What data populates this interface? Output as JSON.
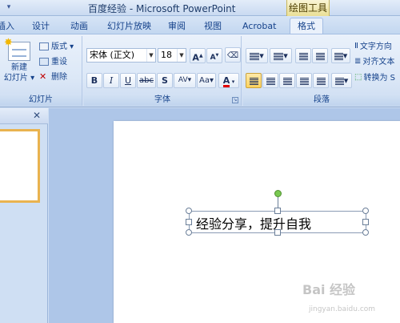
{
  "window": {
    "title": "百度经验 - Microsoft PowerPoint",
    "context_tab_title": "绘图工具"
  },
  "tabs": [
    {
      "label": "插入"
    },
    {
      "label": "设计"
    },
    {
      "label": "动画"
    },
    {
      "label": "幻灯片放映"
    },
    {
      "label": "审阅"
    },
    {
      "label": "视图"
    },
    {
      "label": "Acrobat"
    },
    {
      "label": "格式"
    }
  ],
  "ribbon": {
    "slides_group": {
      "label": "幻灯片",
      "new_slide_line1": "新建",
      "new_slide_line2": "幻灯片",
      "layout": "版式",
      "reset": "重设",
      "delete": "删除"
    },
    "font_group": {
      "label": "字体",
      "font_name": "宋体 (正文)",
      "font_size": "18",
      "bold": "B",
      "italic": "I",
      "underline": "U",
      "strike": "abc",
      "shadow": "S",
      "spacing": "AV",
      "change_case": "Aa",
      "grow": "A",
      "shrink": "A",
      "font_color": "A"
    },
    "paragraph_group": {
      "label": "段落",
      "text_direction": "文字方向",
      "align_text": "对齐文本",
      "convert_smartart": "转换为 S"
    }
  },
  "slide": {
    "textbox_text": "经验分享，提升自我"
  },
  "watermark": {
    "main": "Bai 经验",
    "sub": "jingyan.baidu.com"
  },
  "colors": {
    "ribbon_bg": "#dce8f7",
    "accent_selected": "#ffd35e",
    "context_tab": "#eadf95",
    "font_color_bar": "#e00000",
    "rotation_handle": "#78c850"
  }
}
